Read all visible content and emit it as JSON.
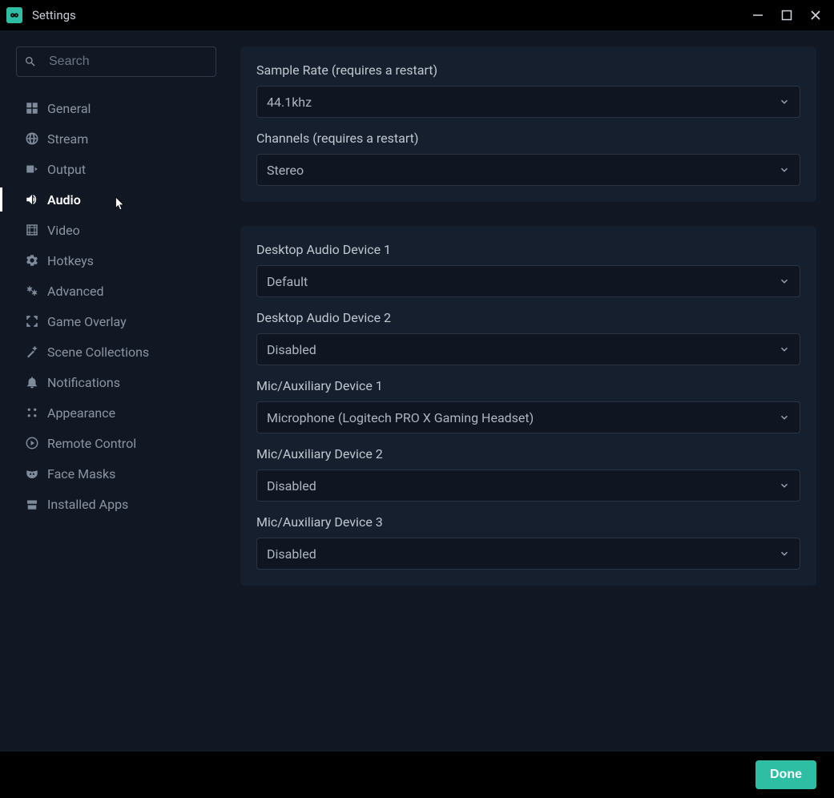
{
  "window": {
    "title": "Settings"
  },
  "search": {
    "placeholder": "Search"
  },
  "sidebar": {
    "items": [
      {
        "id": "general",
        "label": "General",
        "icon": "grid"
      },
      {
        "id": "stream",
        "label": "Stream",
        "icon": "globe"
      },
      {
        "id": "output",
        "label": "Output",
        "icon": "output"
      },
      {
        "id": "audio",
        "label": "Audio",
        "icon": "speaker",
        "active": true
      },
      {
        "id": "video",
        "label": "Video",
        "icon": "film"
      },
      {
        "id": "hotkeys",
        "label": "Hotkeys",
        "icon": "gear"
      },
      {
        "id": "advanced",
        "label": "Advanced",
        "icon": "gears"
      },
      {
        "id": "game-overlay",
        "label": "Game Overlay",
        "icon": "expand"
      },
      {
        "id": "scene-collections",
        "label": "Scene Collections",
        "icon": "wand"
      },
      {
        "id": "notifications",
        "label": "Notifications",
        "icon": "bell"
      },
      {
        "id": "appearance",
        "label": "Appearance",
        "icon": "grip"
      },
      {
        "id": "remote-control",
        "label": "Remote Control",
        "icon": "play-circle"
      },
      {
        "id": "face-masks",
        "label": "Face Masks",
        "icon": "mask"
      },
      {
        "id": "installed-apps",
        "label": "Installed Apps",
        "icon": "store"
      }
    ]
  },
  "panels": [
    {
      "fields": [
        {
          "id": "sample-rate",
          "label": "Sample Rate (requires a restart)",
          "value": "44.1khz"
        },
        {
          "id": "channels",
          "label": "Channels (requires a restart)",
          "value": "Stereo"
        }
      ]
    },
    {
      "fields": [
        {
          "id": "desktop-audio-1",
          "label": "Desktop Audio Device 1",
          "value": "Default"
        },
        {
          "id": "desktop-audio-2",
          "label": "Desktop Audio Device 2",
          "value": "Disabled"
        },
        {
          "id": "mic-aux-1",
          "label": "Mic/Auxiliary Device 1",
          "value": "Microphone (Logitech PRO X Gaming Headset)"
        },
        {
          "id": "mic-aux-2",
          "label": "Mic/Auxiliary Device 2",
          "value": "Disabled"
        },
        {
          "id": "mic-aux-3",
          "label": "Mic/Auxiliary Device 3",
          "value": "Disabled"
        }
      ]
    }
  ],
  "footer": {
    "done": "Done"
  }
}
